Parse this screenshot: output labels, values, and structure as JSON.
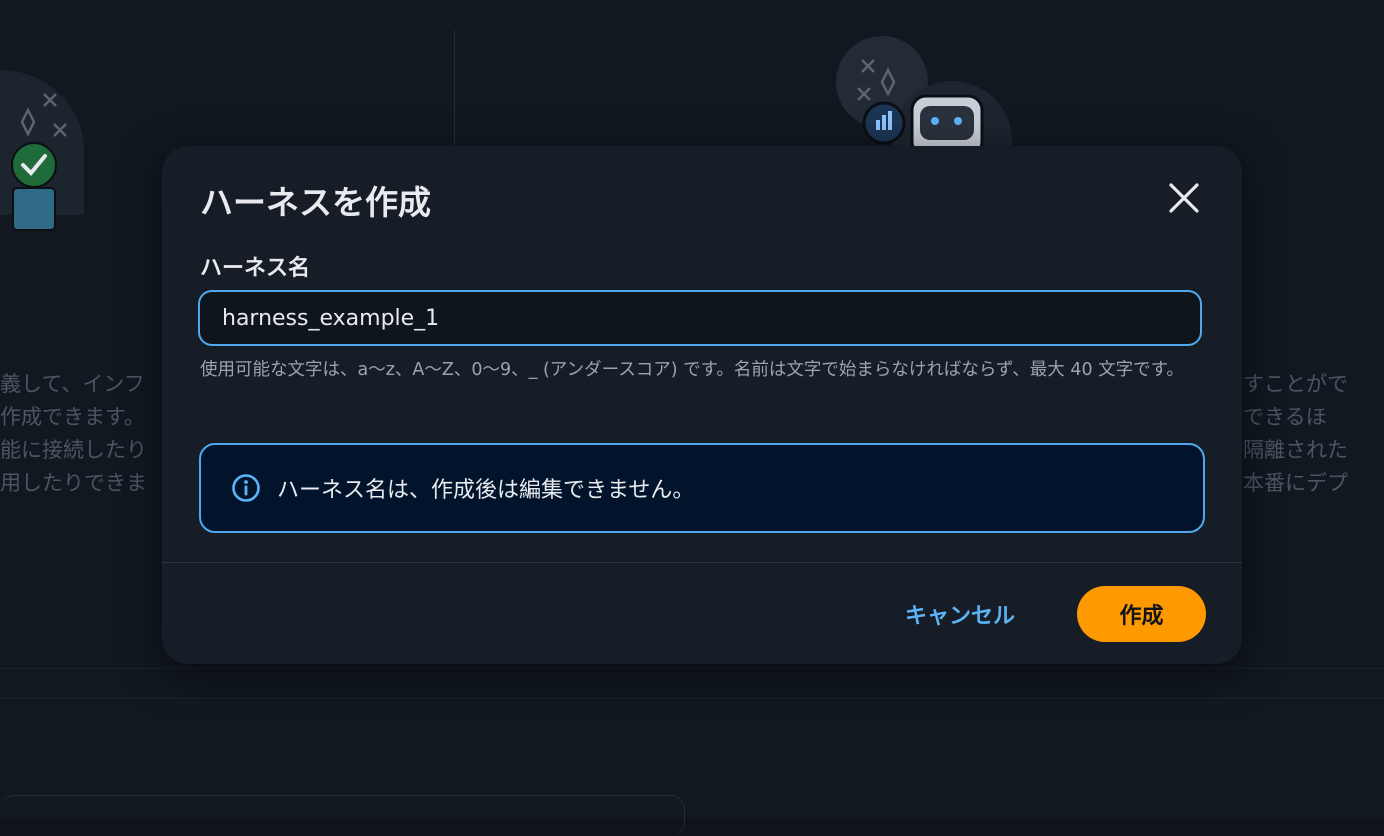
{
  "background": {
    "left_text_lines": [
      "義して、インフ",
      "作成できます。",
      "能に接続したり",
      "用したりできま"
    ],
    "right_text_lines": [
      "すことがで",
      "できるほ",
      "隔離された",
      "本番にデプ"
    ]
  },
  "dialog": {
    "title": "ハーネスを作成",
    "close_icon": "close-icon",
    "field_label": "ハーネス名",
    "input_value": "harness_example_1",
    "hint": "使用可能な文字は、a〜z、A〜Z、0〜9、_ (アンダースコア) です。名前は文字で始まらなければならず、最大 40 文字です。",
    "info_icon": "info-icon",
    "info_text": "ハーネス名は、作成後は編集できません。",
    "cancel_label": "キャンセル",
    "create_label": "作成"
  },
  "colors": {
    "accent_blue": "#4fa9ee",
    "primary_orange": "#ff9900",
    "modal_bg": "#161d26"
  }
}
